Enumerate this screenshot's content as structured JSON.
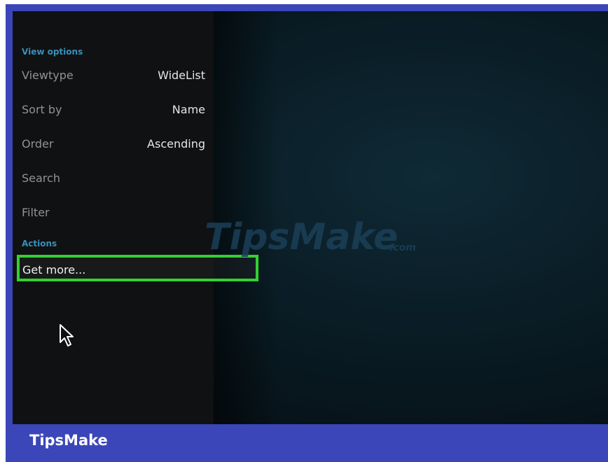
{
  "view_options": {
    "header": "View options",
    "rows": [
      {
        "label": "Viewtype",
        "value": "WideList"
      },
      {
        "label": "Sort by",
        "value": "Name"
      },
      {
        "label": "Order",
        "value": "Ascending"
      },
      {
        "label": "Search",
        "value": ""
      },
      {
        "label": "Filter",
        "value": ""
      }
    ]
  },
  "actions": {
    "header": "Actions",
    "get_more_label": "Get more..."
  },
  "watermark": {
    "main": "TipsMake",
    "suffix": ".com"
  },
  "footer": {
    "brand": "TipsMake"
  },
  "colors": {
    "frame": "#3b46b8",
    "panel": "#101112",
    "section_header": "#3a8fb8",
    "highlight_border": "#33d033"
  }
}
